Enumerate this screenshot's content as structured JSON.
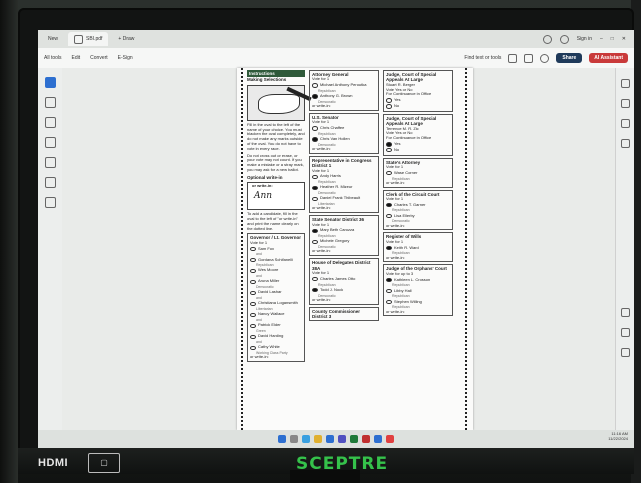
{
  "browser": {
    "tabs": [
      {
        "label": "New"
      },
      {
        "label": "SBI.pdf"
      },
      {
        "label": "+ Draw"
      }
    ],
    "sign_in": "Sign in",
    "menu": [
      "All tools",
      "Edit",
      "Convert",
      "E-Sign"
    ],
    "find_text": "Find text or tools",
    "share_label": "Share",
    "assistant_label": "AI Assistant"
  },
  "ballot": {
    "instructions_header": "Instructions",
    "making_selections": "Making Selections",
    "fill_text": "Fill in the oval to the left of the name of your choice. You must blacken the oval completely, and do not make any marks outside of the oval. You do not have to vote in every race.",
    "no_cross": "Do not cross out or erase, or your vote may not count. If you make a mistake or a stray mark, you may ask for a new ballot.",
    "optional_writein": "Optional write-in",
    "writein_label": "or write-in:",
    "writein_sample": "Ann",
    "writein_note": "To add a candidate, fill in the oval to the left of \"or write-in\" and print the name clearly on the dotted line.",
    "col1_contest": {
      "title": "Governor / Lt. Governor",
      "vote_for": "Vote for 1",
      "candidates": [
        {
          "name": "Sam Fox",
          "party": "and",
          "marked": false
        },
        {
          "name": "Gordana Schifanelli",
          "party": "Republican",
          "marked": false
        },
        {
          "name": "Wes Moore",
          "party": "and",
          "marked": false
        },
        {
          "name": "Aruna Miller",
          "party": "Democratic",
          "marked": false
        },
        {
          "name": "David Lashar",
          "party": "and",
          "marked": false
        },
        {
          "name": "Christiana Logansmith",
          "party": "Libertarian",
          "marked": false
        },
        {
          "name": "Nancy Wallace",
          "party": "and",
          "marked": false
        },
        {
          "name": "Patrick Elder",
          "party": "Green",
          "marked": false
        },
        {
          "name": "David Harding",
          "party": "and",
          "marked": false
        },
        {
          "name": "Cathy White",
          "party": "Working Class Party",
          "marked": false
        }
      ],
      "writein": "or write-in:"
    },
    "col2": [
      {
        "title": "Attorney General",
        "vote_for": "Vote for 1",
        "candidates": [
          {
            "name": "Michael Anthony Peroutka",
            "party": "Republican",
            "marked": false
          },
          {
            "name": "Anthony G. Brown",
            "party": "Democratic",
            "marked": true
          }
        ],
        "writein": "or write-in:"
      },
      {
        "title": "U.S. Senator",
        "vote_for": "Vote for 1",
        "candidates": [
          {
            "name": "Chris Chaffee",
            "party": "Republican",
            "marked": false
          },
          {
            "name": "Chris Van Hollen",
            "party": "Democratic",
            "marked": true
          }
        ],
        "writein": "or write-in:"
      },
      {
        "title": "Representative in Congress District 1",
        "vote_for": "Vote for 1",
        "candidates": [
          {
            "name": "Andy Harris",
            "party": "Republican",
            "marked": false
          },
          {
            "name": "Heather R. Mizeur",
            "party": "Democratic",
            "marked": true
          },
          {
            "name": "Daniel Frank Thibeault",
            "party": "Libertarian",
            "marked": false
          }
        ],
        "writein": "or write-in:"
      },
      {
        "title": "State Senator District 36",
        "vote_for": "Vote for 1",
        "candidates": [
          {
            "name": "Mary Beth Carozza",
            "party": "Republican",
            "marked": true
          },
          {
            "name": "Michele Gregory",
            "party": "Democratic",
            "marked": false
          }
        ],
        "writein": "or write-in:"
      },
      {
        "title": "House of Delegates District 38A",
        "vote_for": "Vote for 1",
        "candidates": [
          {
            "name": "Charles James Otto",
            "party": "Republican",
            "marked": false
          },
          {
            "name": "Todd J. Nock",
            "party": "Democratic",
            "marked": true
          }
        ],
        "writein": "or write-in:"
      },
      {
        "title": "County Commissioner District 3",
        "vote_for": "",
        "candidates": [],
        "writein": ""
      }
    ],
    "col3": [
      {
        "title": "Judge, Court of Special Appeals At Large",
        "subtitle": "Stuart R. Berger",
        "vote_for": "Vote Yes or No",
        "note": "For Continuance in Office",
        "candidates": [
          {
            "name": "Yes",
            "party": "",
            "marked": false
          },
          {
            "name": "No",
            "party": "",
            "marked": false
          }
        ],
        "writein": ""
      },
      {
        "title": "Judge, Court of Special Appeals At Large",
        "subtitle": "Terrence M. R. Zic",
        "vote_for": "Vote Yes or No",
        "note": "For Continuance in Office",
        "candidates": [
          {
            "name": "Yes",
            "party": "",
            "marked": true
          },
          {
            "name": "No",
            "party": "",
            "marked": false
          }
        ],
        "writein": ""
      },
      {
        "title": "State's Attorney",
        "subtitle": "",
        "vote_for": "Vote for 1",
        "note": "",
        "candidates": [
          {
            "name": "Wase Corner",
            "party": "Republican",
            "marked": false
          }
        ],
        "writein": "or write-in:"
      },
      {
        "title": "Clerk of the Circuit Court",
        "subtitle": "",
        "vote_for": "Vote for 1",
        "note": "",
        "candidates": [
          {
            "name": "Charles T. Garner",
            "party": "Republican",
            "marked": true
          },
          {
            "name": "Lisa Ellerby",
            "party": "Democratic",
            "marked": false
          }
        ],
        "writein": "or write-in:"
      },
      {
        "title": "Register of Wills",
        "subtitle": "",
        "vote_for": "Vote for 1",
        "note": "",
        "candidates": [
          {
            "name": "Keith R. Ward",
            "party": "Republican",
            "marked": true
          }
        ],
        "writein": "or write-in:"
      },
      {
        "title": "Judge of the Orphans' Court",
        "subtitle": "",
        "vote_for": "Vote for up to 3",
        "note": "",
        "candidates": [
          {
            "name": "Kathleen L. Crosson",
            "party": "Republican",
            "marked": true
          },
          {
            "name": "Libby Hall",
            "party": "Republican",
            "marked": false
          },
          {
            "name": "Stephen Willing",
            "party": "Republican",
            "marked": false
          }
        ],
        "writein": "or write-in:"
      }
    ]
  },
  "taskbar": {
    "time": "11:16 AM",
    "date": "11/22/2024"
  },
  "monitor": {
    "port_label": "HDMI",
    "brand": "SCEPTRE"
  }
}
